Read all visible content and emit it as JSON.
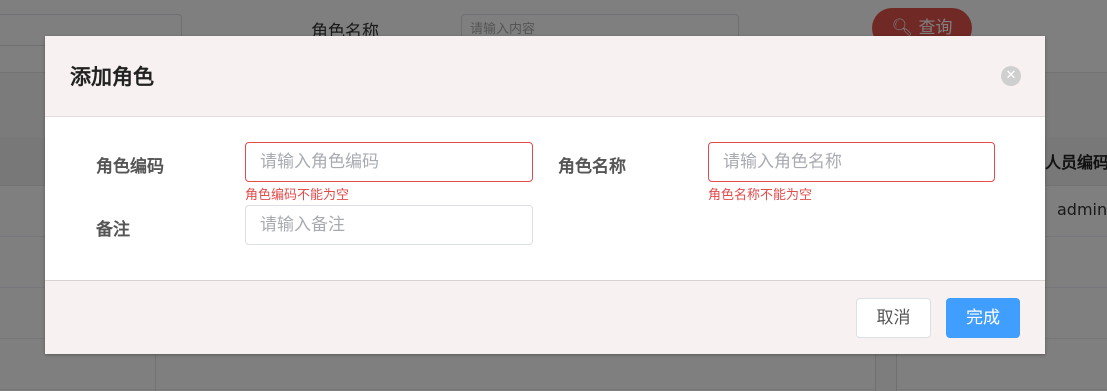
{
  "background": {
    "search_label": "角色名称",
    "search_placeholder": "请输入内容",
    "query_button": "查询",
    "query_icon": "search-icon",
    "table_header_partial": "人员编码",
    "table_cell_partial": "admin"
  },
  "dialog": {
    "title": "添加角色",
    "close_icon": "close-icon",
    "fields": {
      "role_code": {
        "label": "角色编码",
        "placeholder": "请输入角色编码",
        "value": "",
        "error": "角色编码不能为空"
      },
      "role_name": {
        "label": "角色名称",
        "placeholder": "请输入角色名称",
        "value": "",
        "error": "角色名称不能为空"
      },
      "remark": {
        "label": "备注",
        "placeholder": "请输入备注",
        "value": ""
      }
    },
    "buttons": {
      "cancel": "取消",
      "ok": "完成"
    }
  },
  "colors": {
    "primary": "#409eff",
    "error": "#e34b4b",
    "danger_button": "#e0524a"
  }
}
